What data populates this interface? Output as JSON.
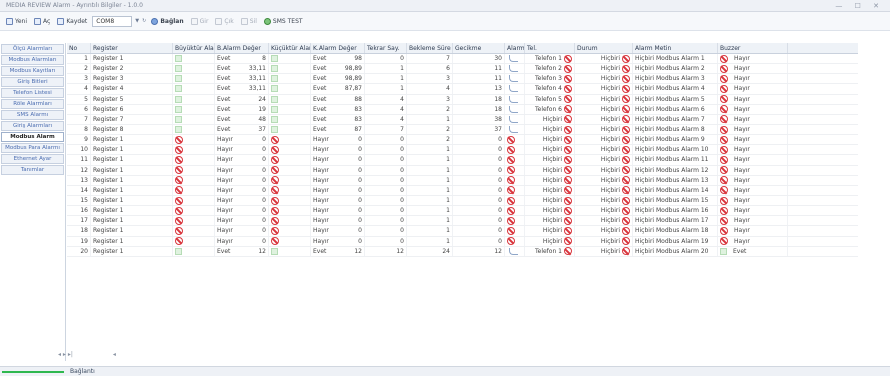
{
  "window": {
    "title": "MEDIA REVIEW Alarm - Ayrıntılı Bilgiler - 1.0.0",
    "controls": "— ☐ ✕"
  },
  "toolbar": {
    "new": "Yeni",
    "open": "Aç",
    "save": "Kaydet",
    "select_value": "COM8",
    "connect": "Bağlan",
    "b1": "Gir",
    "b2": "Çık",
    "b3": "Sil",
    "test": "SMS TEST"
  },
  "sidebar": [
    "Ölçü Alarmları",
    "Modbus Alarmları",
    "Modbus Kayıtları",
    "Giriş Bitleri",
    "Telefon Listesi",
    "Röle Alarmları",
    "SMS Alarmı",
    "Giriş Alarmları",
    "Modbus Alarm",
    "Modbus Para Alarmı",
    "Ethernet Ayar",
    "Tanımlar"
  ],
  "sidebar_active": 8,
  "columns": [
    "No",
    "Register",
    "Büyüktür Alarm",
    "B.Alarm Değer",
    "Küçüktür Alarm",
    "K.Alarm Değer",
    "Tekrar Say.",
    "Bekleme Süre",
    "Gecikme",
    "Alarm",
    "Tel.",
    "Durum",
    "Alarm Metin",
    "Buzzer"
  ],
  "rows": [
    [
      "1",
      "Register 1",
      "g",
      "Evet",
      "8",
      "g",
      "Evet",
      "98",
      "0",
      "7",
      "30",
      "w",
      "Telefon 1",
      "Hiçbiri",
      "Hiçbiri Modbus Alarm 1",
      "Hayır"
    ],
    [
      "2",
      "Register 2",
      "g",
      "Evet",
      "33,11",
      "g",
      "Evet",
      "98,89",
      "1",
      "6",
      "11",
      "w",
      "Telefon 2",
      "Hiçbiri",
      "Hiçbiri Modbus Alarm 2",
      "Hayır"
    ],
    [
      "3",
      "Register 3",
      "g",
      "Evet",
      "33,11",
      "g",
      "Evet",
      "98,89",
      "1",
      "3",
      "11",
      "w",
      "Telefon 3",
      "Hiçbiri",
      "Hiçbiri Modbus Alarm 3",
      "Hayır"
    ],
    [
      "4",
      "Register 4",
      "g",
      "Evet",
      "33,11",
      "g",
      "Evet",
      "87,87",
      "1",
      "4",
      "13",
      "w",
      "Telefon 4",
      "Hiçbiri",
      "Hiçbiri Modbus Alarm 4",
      "Hayır"
    ],
    [
      "5",
      "Register 5",
      "g",
      "Evet",
      "24",
      "g",
      "Evet",
      "88",
      "4",
      "3",
      "18",
      "w",
      "Telefon 5",
      "Hiçbiri",
      "Hiçbiri Modbus Alarm 5",
      "Hayır"
    ],
    [
      "6",
      "Register 6",
      "g",
      "Evet",
      "19",
      "g",
      "Evet",
      "83",
      "4",
      "2",
      "18",
      "w",
      "Telefon 6",
      "Hiçbiri",
      "Hiçbiri Modbus Alarm 6",
      "Hayır"
    ],
    [
      "7",
      "Register 7",
      "g",
      "Evet",
      "48",
      "g",
      "Evet",
      "83",
      "4",
      "1",
      "38",
      "w",
      "Hiçbiri",
      "Hiçbiri",
      "Hiçbiri Modbus Alarm 7",
      "Hayır"
    ],
    [
      "8",
      "Register 8",
      "g",
      "Evet",
      "37",
      "g",
      "Evet",
      "87",
      "7",
      "2",
      "37",
      "w",
      "Hiçbiri",
      "Hiçbiri",
      "Hiçbiri Modbus Alarm 8",
      "Hayır"
    ],
    [
      "9",
      "Register 1",
      "b",
      "Hayır",
      "0",
      "b",
      "Hayır",
      "0",
      "0",
      "2",
      "0",
      "b",
      "Hiçbiri",
      "Hiçbiri",
      "Hiçbiri Modbus Alarm 9",
      "Hayır"
    ],
    [
      "10",
      "Register 1",
      "b",
      "Hayır",
      "0",
      "b",
      "Hayır",
      "0",
      "0",
      "1",
      "0",
      "b",
      "Hiçbiri",
      "Hiçbiri",
      "Hiçbiri Modbus Alarm 10",
      "Hayır"
    ],
    [
      "11",
      "Register 1",
      "b",
      "Hayır",
      "0",
      "b",
      "Hayır",
      "0",
      "0",
      "1",
      "0",
      "b",
      "Hiçbiri",
      "Hiçbiri",
      "Hiçbiri Modbus Alarm 11",
      "Hayır"
    ],
    [
      "12",
      "Register 1",
      "b",
      "Hayır",
      "0",
      "b",
      "Hayır",
      "0",
      "0",
      "1",
      "0",
      "b",
      "Hiçbiri",
      "Hiçbiri",
      "Hiçbiri Modbus Alarm 12",
      "Hayır"
    ],
    [
      "13",
      "Register 1",
      "b",
      "Hayır",
      "0",
      "b",
      "Hayır",
      "0",
      "0",
      "1",
      "0",
      "b",
      "Hiçbiri",
      "Hiçbiri",
      "Hiçbiri Modbus Alarm 13",
      "Hayır"
    ],
    [
      "14",
      "Register 1",
      "b",
      "Hayır",
      "0",
      "b",
      "Hayır",
      "0",
      "0",
      "1",
      "0",
      "b",
      "Hiçbiri",
      "Hiçbiri",
      "Hiçbiri Modbus Alarm 14",
      "Hayır"
    ],
    [
      "15",
      "Register 1",
      "b",
      "Hayır",
      "0",
      "b",
      "Hayır",
      "0",
      "0",
      "1",
      "0",
      "b",
      "Hiçbiri",
      "Hiçbiri",
      "Hiçbiri Modbus Alarm 15",
      "Hayır"
    ],
    [
      "16",
      "Register 1",
      "b",
      "Hayır",
      "0",
      "b",
      "Hayır",
      "0",
      "0",
      "1",
      "0",
      "b",
      "Hiçbiri",
      "Hiçbiri",
      "Hiçbiri Modbus Alarm 16",
      "Hayır"
    ],
    [
      "17",
      "Register 1",
      "b",
      "Hayır",
      "0",
      "b",
      "Hayır",
      "0",
      "0",
      "1",
      "0",
      "b",
      "Hiçbiri",
      "Hiçbiri",
      "Hiçbiri Modbus Alarm 17",
      "Hayır"
    ],
    [
      "18",
      "Register 1",
      "b",
      "Hayır",
      "0",
      "b",
      "Hayır",
      "0",
      "0",
      "1",
      "0",
      "b",
      "Hiçbiri",
      "Hiçbiri",
      "Hiçbiri Modbus Alarm 18",
      "Hayır"
    ],
    [
      "19",
      "Register 1",
      "b",
      "Hayır",
      "0",
      "b",
      "Hayır",
      "0",
      "0",
      "1",
      "0",
      "b",
      "Hiçbiri",
      "Hiçbiri",
      "Hiçbiri Modbus Alarm 19",
      "Hayır"
    ],
    [
      "20",
      "Register 1",
      "g",
      "Evet",
      "12",
      "g",
      "Evet",
      "12",
      "12",
      "24",
      "12",
      "w",
      "Telefon 1",
      "Hiçbiri",
      "Hiçbiri Modbus Alarm 20",
      "Evet"
    ]
  ],
  "pager": {
    "left": "◂ ▸ ▸|",
    "right": "◂"
  },
  "status": {
    "label": "Bağlantı"
  }
}
